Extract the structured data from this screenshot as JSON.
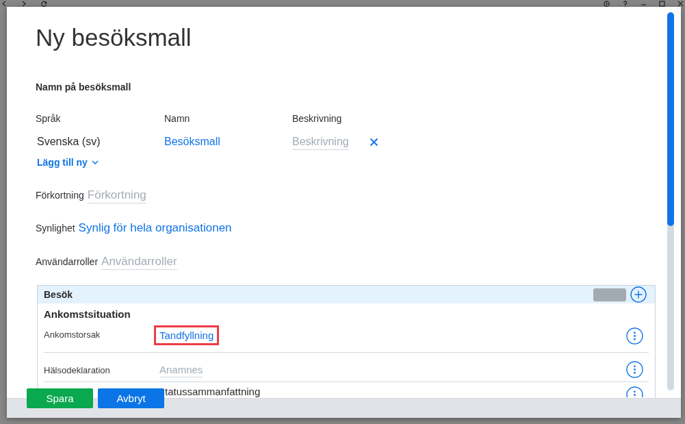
{
  "dialog": {
    "title": "Ny besöksmall"
  },
  "name_section": {
    "heading": "Namn på besöksmall",
    "columns": [
      "Språk",
      "Namn",
      "Beskrivning"
    ],
    "rows": [
      {
        "language": "Svenska (sv)",
        "name": "Besöksmall",
        "description": {
          "placeholder": "Beskrivning"
        }
      }
    ],
    "add_new": "Lägg till ny"
  },
  "fields": [
    {
      "label": "Förkortning",
      "kind": "input",
      "placeholder": "Förkortning"
    },
    {
      "label": "Synlighet",
      "kind": "link",
      "value": "Synlig för hela organisationen"
    },
    {
      "label": "Användarroller",
      "kind": "input",
      "placeholder": "Användarroller"
    }
  ],
  "panel": {
    "title": "Besök",
    "group": "Ankomstsituation",
    "rows": [
      {
        "label": "Ankomstorsak",
        "kind": "link",
        "value": "Tandfyllning",
        "highlighted": true
      },
      {
        "label": "Hälsodeklaration",
        "kind": "input",
        "placeholder": "Anamnes",
        "highlighted": false
      },
      {
        "kind": "text",
        "value": "tatussammanfattning",
        "highlighted": false
      }
    ]
  },
  "buttons": [
    {
      "label": "Spara",
      "kind": "primary"
    },
    {
      "label": "Avbryt",
      "kind": "secondary"
    }
  ]
}
